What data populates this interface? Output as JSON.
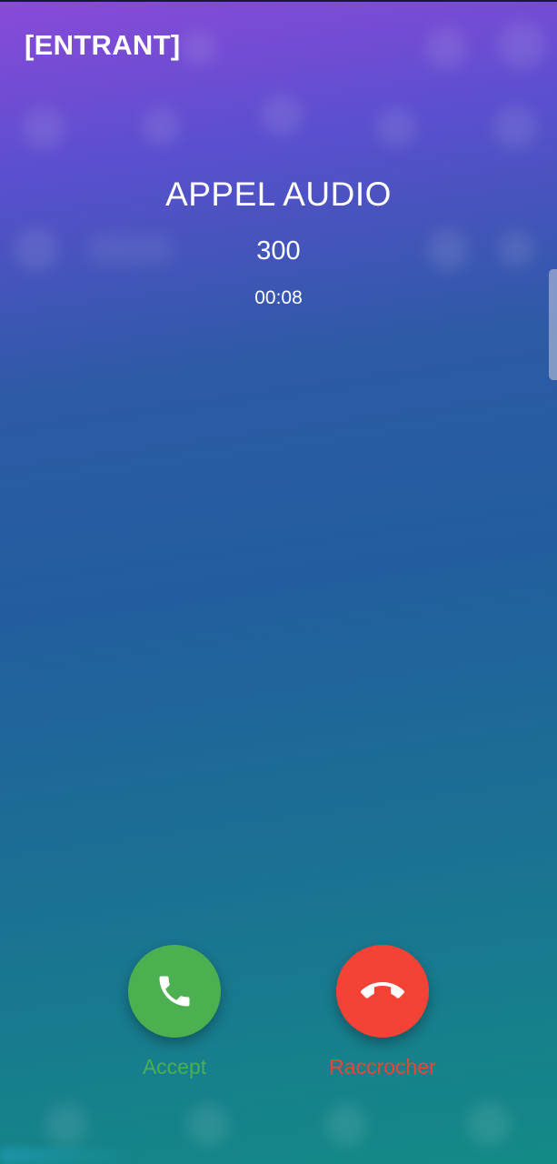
{
  "call": {
    "state": "[ENTRANT]",
    "type": "APPEL AUDIO",
    "number": "300",
    "duration": "00:08"
  },
  "actions": {
    "accept_label": "Accept",
    "hangup_label": "Raccrocher",
    "accept_icon": "phone-icon",
    "hangup_icon": "phone-hangup-icon"
  },
  "colors": {
    "accept": "#4caf50",
    "hangup": "#f44336",
    "text": "#ffffff",
    "gradient_top": "#8a4ad8",
    "gradient_bottom": "#138a86"
  }
}
